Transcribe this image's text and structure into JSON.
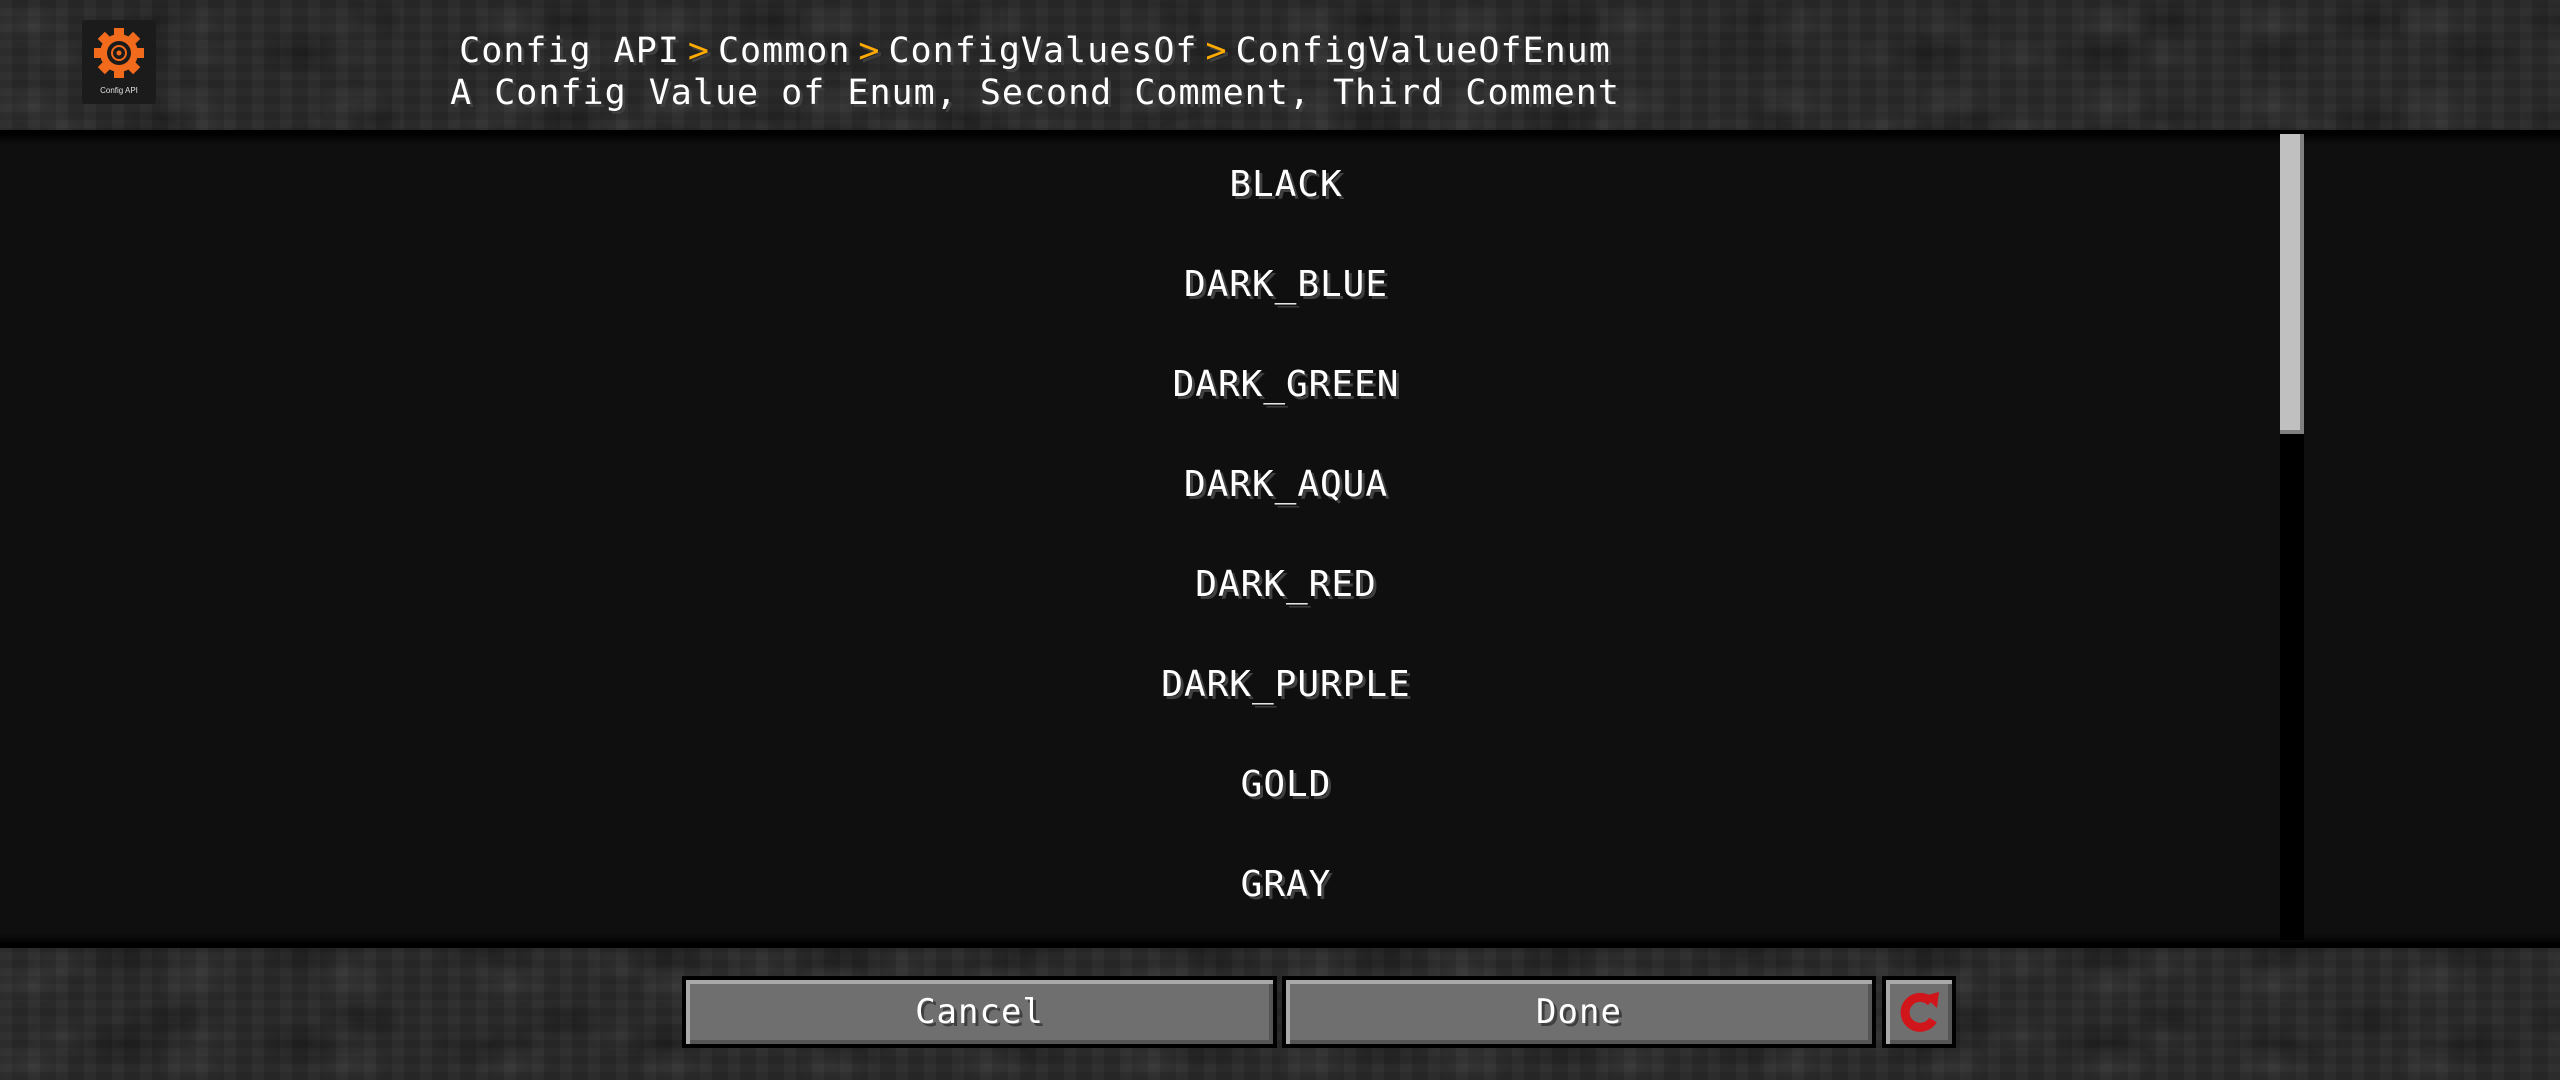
{
  "logo": {
    "label": "Config API",
    "icon": "gear-icon"
  },
  "breadcrumb": {
    "items": [
      "Config API",
      "Common",
      "ConfigValuesOf",
      "ConfigValueOfEnum"
    ],
    "separator": ">"
  },
  "subtitle": "A Config Value of Enum, Second Comment, Third Comment",
  "enum_values": [
    "BLACK",
    "DARK_BLUE",
    "DARK_GREEN",
    "DARK_AQUA",
    "DARK_RED",
    "DARK_PURPLE",
    "GOLD",
    "GRAY"
  ],
  "buttons": {
    "cancel": "Cancel",
    "done": "Done",
    "reset_icon": "reset-icon"
  },
  "colors": {
    "separator": "#ffaa00",
    "reset": "#d0161a",
    "gear": "#f26b1d"
  }
}
